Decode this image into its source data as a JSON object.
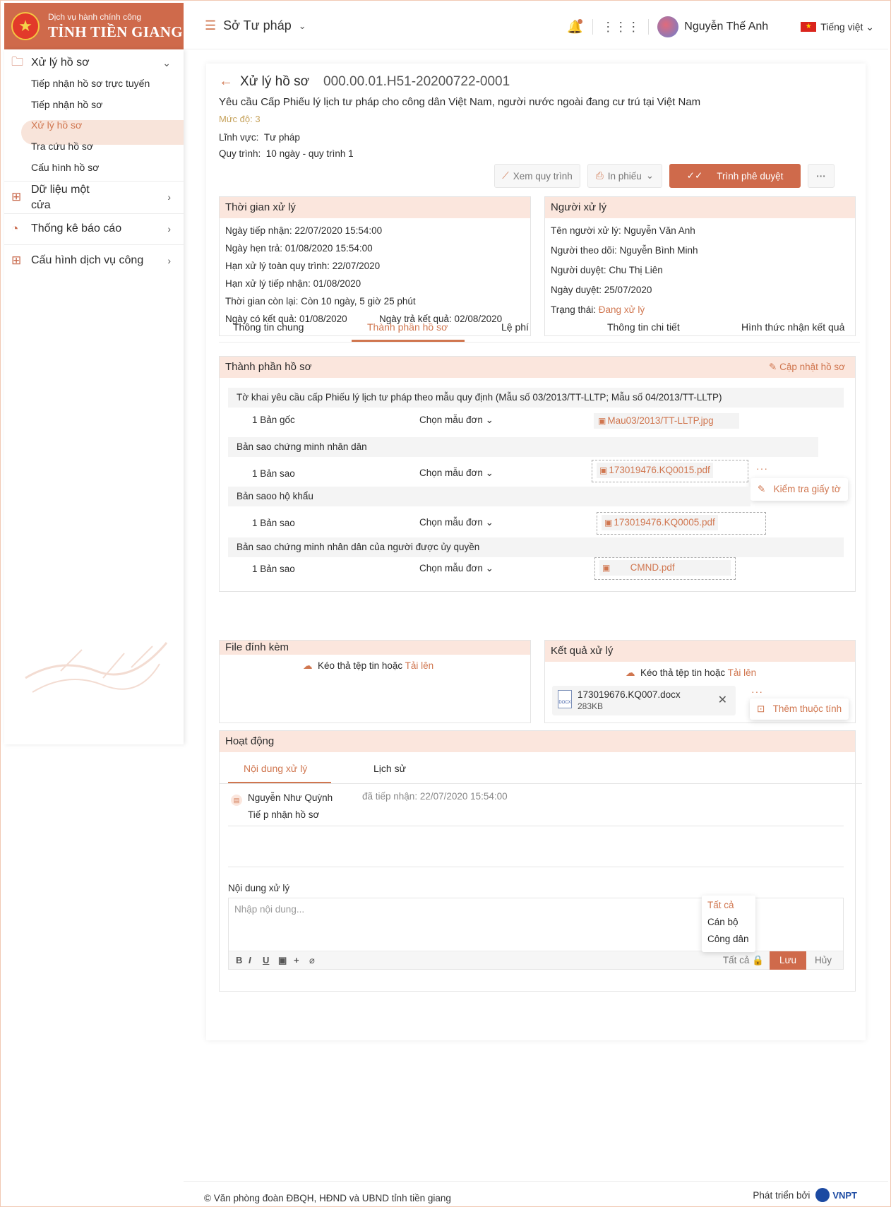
{
  "brand": {
    "subtitle": "Dịch vụ hành chính công",
    "title": "TỈNH TIỀN GIANG"
  },
  "sidebar": {
    "group_process": {
      "label": "Xử lý hồ sơ",
      "icon": "folder-icon"
    },
    "items": [
      {
        "label": "Tiếp nhận hồ sơ trực tuyến"
      },
      {
        "label": "Tiếp nhận hồ sơ"
      },
      {
        "label": "Xử lý hồ sơ",
        "active": true
      },
      {
        "label": "Tra cứu hồ sơ"
      },
      {
        "label": "Cấu hình hồ sơ"
      }
    ],
    "group_data": {
      "label_line1": "Dữ liệu một",
      "label_line2": "cửa",
      "icon": "sitemap-icon"
    },
    "group_stats": {
      "label": "Thống kê báo cáo",
      "icon": "pie-chart-icon"
    },
    "group_config": {
      "label": "Cấu hình dịch vụ công",
      "icon": "apps-icon"
    }
  },
  "topbar": {
    "org": "Sở Tư pháp",
    "user_name": "Nguyễn Thế Anh",
    "language": "Tiếng việt"
  },
  "dossier": {
    "heading": "Xử lý hồ sơ",
    "code": "000.00.01.H51-20200722-0001",
    "request_title": "Yêu cầu Cấp Phiếu lý lịch tư pháp cho công dân Việt Nam, người nước ngoài đang cư trú tại Việt Nam",
    "level": "Mức độ: 3",
    "field_label": "Lĩnh vực:",
    "field_value": "Tư pháp",
    "process_label": "Quy trình:",
    "process_value": "10 ngày - quy trình 1"
  },
  "actions": {
    "view_process": "Xem quy trình",
    "print": "In phiếu",
    "submit": "Trình phê duyệt",
    "more": "···"
  },
  "time_panel": {
    "title": "Thời gian xử lý",
    "received": "Ngày tiếp nhận: 22/07/2020 15:54:00",
    "appointment": "Ngày hẹn trả: 01/08/2020 15:54:00",
    "deadline_all": "Hạn xử lý toàn quy trình: 22/07/2020",
    "deadline_receive": "Hạn xử lý tiếp nhận: 01/08/2020",
    "remaining": "Thời gian còn lại: Còn 10 ngày, 5 giờ 25 phút",
    "result_date": "Ngày có kết quả: 01/08/2020",
    "return_date": "Ngày trả kết quả:  02/08/2020"
  },
  "handler_panel": {
    "title": "Người xử lý",
    "handler": "Tên người xử lý: Nguyễn Văn Anh",
    "follower": "Người theo dõi: Nguyễn Bình Minh",
    "approver": "Người duyệt: Chu Thị Liên",
    "approve_date": "Ngày duyệt: 25/07/2020",
    "status_label": "Trạng thái: ",
    "status_value": "Đang xử lý"
  },
  "tabs": [
    "Thông tin chung",
    "Thành phần hồ sơ",
    "Lệ phí",
    "Thông tin chi tiết",
    "Hình thức nhận kết quả"
  ],
  "components": {
    "title": "Thành phần hồ sơ",
    "update_label": "Cập nhật hồ sơ",
    "choose_label": "Chọn mẫu đơn",
    "docs": [
      {
        "name": "Tờ khai yêu cầu cấp Phiếu lý lịch tư pháp theo mẫu quy định (Mẫu số 03/2013/TT-LLTP; Mẫu số 04/2013/TT-LLTP)",
        "qty": "1  Bản gốc",
        "file": "Mau03/2013/TT-LLTP.jpg"
      },
      {
        "name": "Bản sao chứng minh nhân dân",
        "qty": "1  Bản sao",
        "file": "173019476.KQ0015.pdf"
      },
      {
        "name": "Bản saoo hộ khẩu",
        "qty": "1  Bản sao",
        "file": "173019476.KQ0005.pdf"
      },
      {
        "name": "Bản sao chứng minh nhân dân của người được ủy quyền",
        "qty": "1  Bản sao",
        "file": "CMND.pdf"
      }
    ],
    "check_docs": "Kiểm tra giấy tờ"
  },
  "attachments": {
    "title": "File đính kèm",
    "drop_text": "Kéo thả tệp tin hoặc ",
    "upload_link": "Tải lên"
  },
  "result": {
    "title": "Kết quả xử lý",
    "drop_text": "Kéo thả tệp tin hoặc ",
    "upload_link": "Tải lên",
    "file_name": "173019676.KQ007.docx",
    "file_size": "283KB",
    "add_property": "Thêm thuộc tính"
  },
  "activity": {
    "title": "Hoạt động",
    "tab_content": "Nội dung xử lý",
    "tab_history": "Lịch sử",
    "entry_user": "Nguyễn Như Quỳnh",
    "entry_meta": "đã tiếp nhận: 22/07/2020 15:54:00",
    "entry_text": "Tiế p nhận hồ sơ",
    "input_label": "Nội dung xử lý",
    "input_placeholder": "Nhập nội dung...",
    "scope": "Tất cả",
    "save": "Lưu",
    "cancel": "Hủy",
    "scope_options": [
      "Tất cả",
      "Cán bộ",
      "Công dân"
    ]
  },
  "footer": {
    "copyright": "© Văn phòng đoàn ĐBQH, HĐND và UBND tỉnh tiền giang",
    "developed_by": "Phát triển bởi",
    "vendor": "VNPT"
  }
}
